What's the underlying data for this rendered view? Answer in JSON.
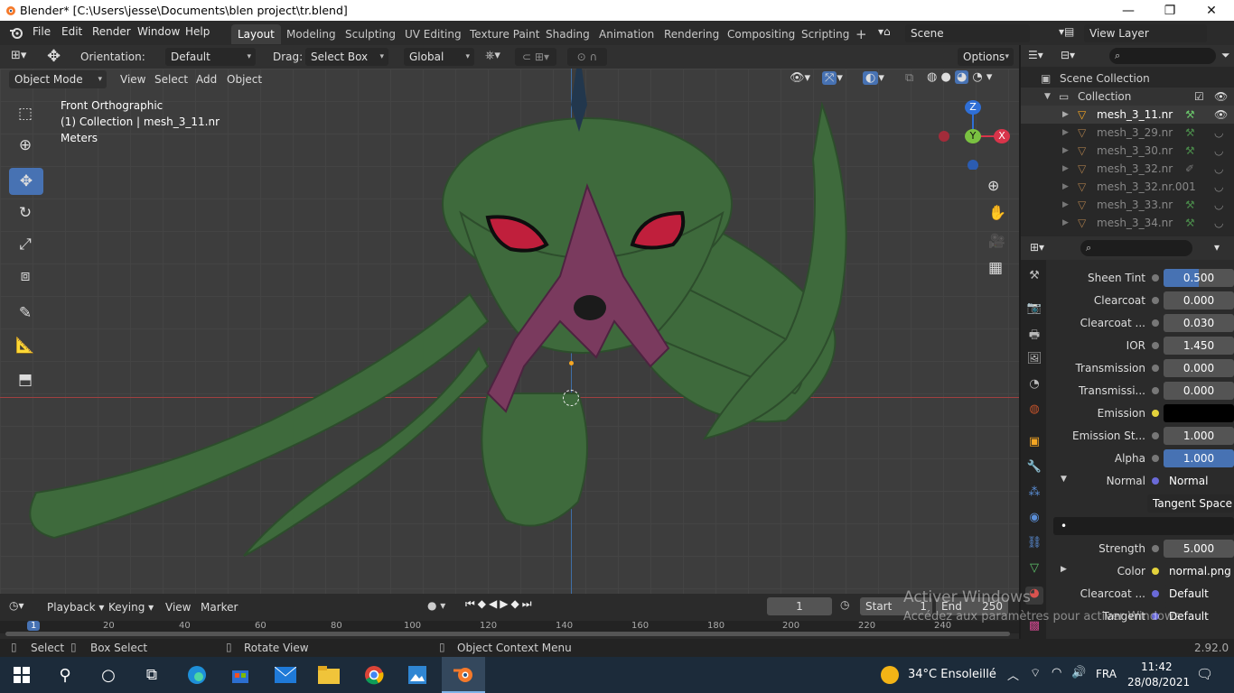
{
  "window": {
    "title": "Blender* [C:\\Users\\jesse\\Documents\\blen project\\tr.blend]",
    "minimize": "—",
    "maximize": "❐",
    "close": "✕"
  },
  "menu": [
    "File",
    "Edit",
    "Render",
    "Window",
    "Help"
  ],
  "workspaces": [
    "Layout",
    "Modeling",
    "Sculpting",
    "UV Editing",
    "Texture Paint",
    "Shading",
    "Animation",
    "Rendering",
    "Compositing",
    "Scripting"
  ],
  "add_workspace": "+",
  "scene": {
    "label": "Scene",
    "view_layer": "View Layer"
  },
  "header": {
    "orientation_label": "Orientation:",
    "orientation_value": "Default",
    "drag_label": "Drag:",
    "drag_value": "Select Box",
    "transform_value": "Global",
    "options": "Options"
  },
  "viewport_header": {
    "mode": "Object Mode",
    "menus": [
      "View",
      "Select",
      "Add",
      "Object"
    ]
  },
  "viewport_info": {
    "view": "Front Orthographic",
    "collection": "(1) Collection | mesh_3_11.nr",
    "units": "Meters"
  },
  "gizmo": {
    "z": "Z",
    "y": "Y",
    "x": "X"
  },
  "outliner": {
    "scene_collection": "Scene Collection",
    "collection": "Collection",
    "items": [
      "mesh_3_11.nr",
      "mesh_3_29.nr",
      "mesh_3_30.nr",
      "mesh_3_32.nr",
      "mesh_3_32.nr.001",
      "mesh_3_33.nr",
      "mesh_3_34.nr"
    ]
  },
  "properties": {
    "rows": [
      {
        "label": "Sheen Tint",
        "value": "0.500",
        "style": "slider-half"
      },
      {
        "label": "Clearcoat",
        "value": "0.000",
        "style": "num"
      },
      {
        "label": "Clearcoat ...",
        "value": "0.030",
        "style": "num"
      },
      {
        "label": "IOR",
        "value": "1.450",
        "style": "num"
      },
      {
        "label": "Transmission",
        "value": "0.000",
        "style": "num"
      },
      {
        "label": "Transmissi...",
        "value": "0.000",
        "style": "num"
      },
      {
        "label": "Emission",
        "value": "",
        "style": "color"
      },
      {
        "label": "Emission St...",
        "value": "1.000",
        "style": "num"
      },
      {
        "label": "Alpha",
        "value": "1.000",
        "style": "slider-full"
      }
    ],
    "normal": {
      "label": "Normal",
      "value": "Normal Map",
      "space": "Tangent Space",
      "field": "•",
      "strength_label": "Strength",
      "strength": "5.000",
      "color_label": "Color",
      "color_value": "normal.png",
      "clearcoat_label": "Clearcoat ...",
      "clearcoat_value": "Default",
      "tangent_label": "Tangent",
      "tangent_value": "Default"
    }
  },
  "timeline": {
    "menus": [
      "Playback",
      "Keying",
      "View",
      "Marker"
    ],
    "current_frame": "1",
    "start_label": "Start",
    "start": "1",
    "end_label": "End",
    "end": "250",
    "ruler": [
      "1",
      "20",
      "40",
      "60",
      "80",
      "100",
      "120",
      "140",
      "160",
      "180",
      "200",
      "220",
      "240"
    ]
  },
  "watermark": {
    "line1": "Activer Windows",
    "line2": "Accédez aux paramètres pour activer Windows."
  },
  "status": {
    "select": "Select",
    "box_select": "Box Select",
    "rotate": "Rotate View",
    "context": "Object Context Menu",
    "version": "2.92.0"
  },
  "taskbar": {
    "weather": "34°C  Ensoleillé",
    "lang": "FRA",
    "time": "11:42",
    "date": "28/08/2021"
  },
  "colors": {
    "accent": "#4772b3",
    "header": "#303030",
    "viewport_bg": "#3d3d3d",
    "creature": "#3f6a3e"
  }
}
